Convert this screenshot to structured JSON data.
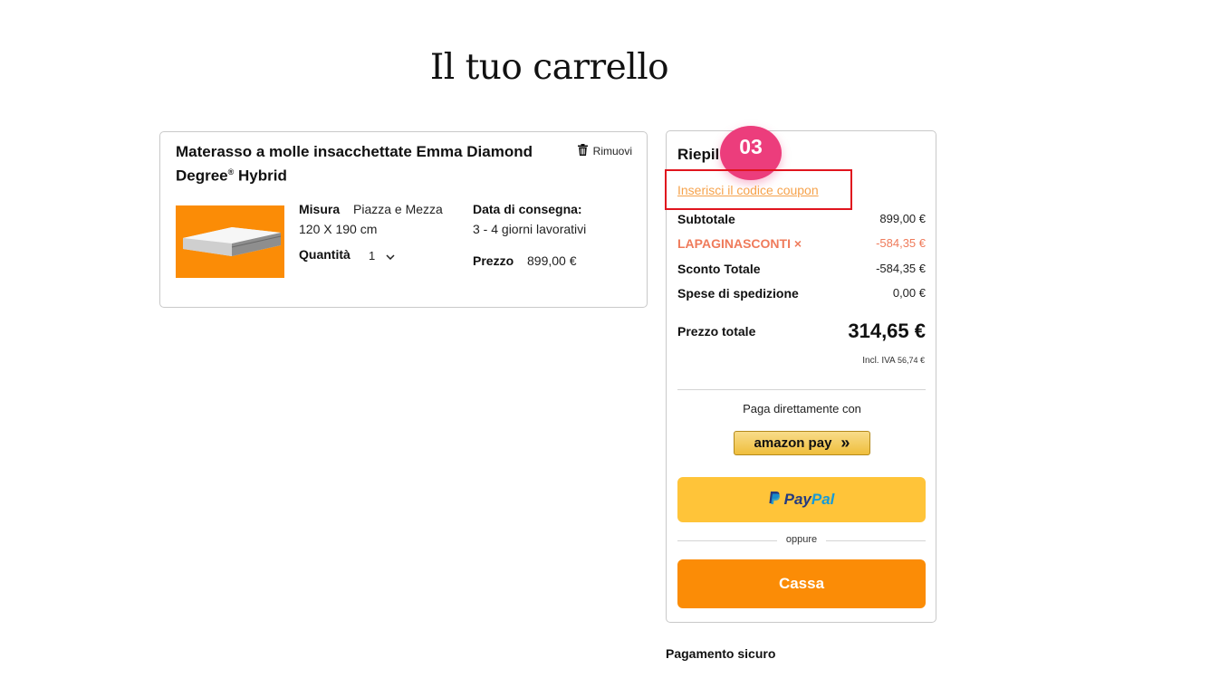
{
  "page": {
    "title": "Il tuo carrello"
  },
  "product": {
    "name": "Materasso a molle insacchettate Emma Diamond Degree",
    "name_mark": "®",
    "name_suffix": " Hybrid",
    "remove_label": "Rimuovi",
    "size_label": "Misura",
    "size_value": "Piazza e Mezza",
    "dimensions": "120 X 190 cm",
    "quantity_label": "Quantità",
    "quantity_value": "1",
    "delivery_label": "Data di consegna:",
    "delivery_value": "3 - 4 giorni lavorativi",
    "price_label": "Prezzo",
    "price_value": "899,00 €"
  },
  "summary": {
    "title": "Riepil",
    "step_badge": "03",
    "coupon_link": "Inserisci il codice coupon",
    "rows": [
      {
        "label": "Subtotale",
        "value": "899,00 €"
      },
      {
        "label": "LAPAGINASCONTI ×",
        "value": "-584,35 €"
      },
      {
        "label": "Sconto Totale",
        "value": "-584,35 €"
      },
      {
        "label": "Spese di spedizione",
        "value": "0,00 €"
      }
    ],
    "total_label": "Prezzo totale",
    "total_value": "314,65 €",
    "vat_label": "Incl. IVA",
    "vat_value": "56,74 €",
    "pay_direct_label": "Paga direttamente con",
    "amazon_label": "amazon pay",
    "amazon_arrows": "»",
    "paypal_pay": "Pay",
    "paypal_pal": "Pal",
    "or_label": "oppure",
    "checkout_label": "Cassa"
  },
  "secure_payment": {
    "title": "Pagamento sicuro"
  },
  "colors": {
    "accent_orange": "#fb8c06",
    "discount": "#ef7b5b",
    "coupon_link": "#f6a24b",
    "badge": "#ec3d7c",
    "highlight": "#e0141e",
    "paypal_yellow": "#ffc439"
  }
}
